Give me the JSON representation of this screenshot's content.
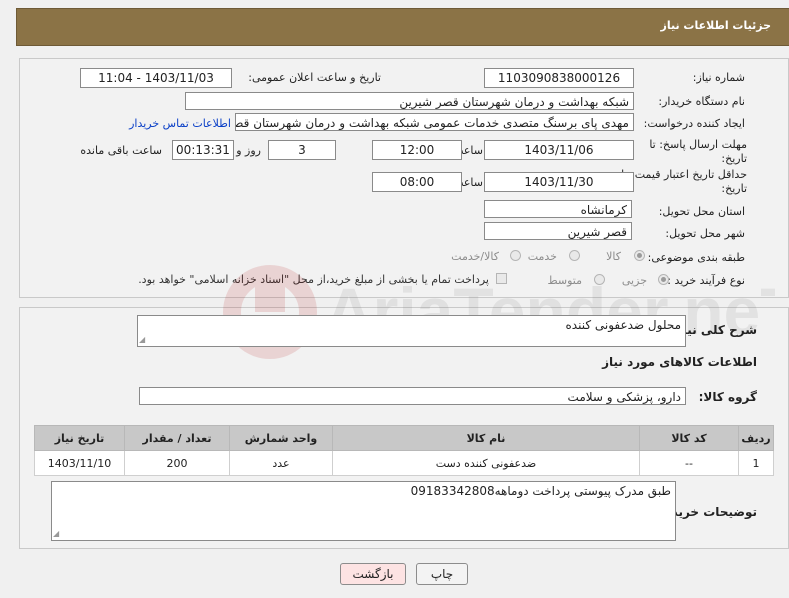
{
  "header": {
    "title": "جزئیات اطلاعات نیاز"
  },
  "form": {
    "need_number_label": "شماره نیاز:",
    "need_number": "1103090838000126",
    "announce_label": "تاریخ و ساعت اعلان عمومی:",
    "announce_value": "1403/11/03 - 11:04",
    "buyer_org_label": "نام دستگاه خریدار:",
    "buyer_org": "شبکه بهداشت و درمان شهرستان قصر شیرین",
    "requester_label": "ایجاد کننده درخواست:",
    "requester": "مهدی پای برسنگ متصدی خدمات عمومی شبکه بهداشت و درمان شهرستان قصر شیرین",
    "contact_link": "اطلاعات تماس خریدار",
    "reply_deadline_label": "مهلت ارسال پاسخ: تا تاریخ:",
    "reply_date": "1403/11/06",
    "time_label": "ساعت",
    "reply_time": "12:00",
    "days_value": "3",
    "days_label": "روز و",
    "remaining_value": "00:13:31",
    "remaining_label": "ساعت باقی مانده",
    "price_deadline_label": "حداقل تاریخ اعتبار قیمت: تا تاریخ:",
    "price_date": "1403/11/30",
    "price_time": "08:00",
    "province_label": "استان محل تحویل:",
    "province": "کرمانشاه",
    "city_label": "شهر محل تحویل:",
    "city": "قصر شیرین",
    "category_label": "طبقه بندی موضوعی:",
    "category_options": [
      "کالا",
      "خدمت",
      "کالا/خدمت"
    ],
    "category_selected": "کالا",
    "process_label": "نوع فرآیند خرید :",
    "process_options": [
      "جزیی",
      "متوسط"
    ],
    "process_selected": "جزیی",
    "payment_note": "پرداخت تمام یا بخشی از مبلغ خرید،از محل \"اسناد خزانه اسلامی\" خواهد بود."
  },
  "description": {
    "label": "شرح کلی نیاز:",
    "value": "محلول ضدعفونی کننده",
    "goods_info_title": "اطلاعات کالاهای مورد نیاز",
    "group_label": "گروه کالا:",
    "group_value": "دارو، پزشکی و سلامت"
  },
  "table": {
    "headers": [
      "ردیف",
      "کد کالا",
      "نام کالا",
      "واحد شمارش",
      "تعداد / مقدار",
      "تاریخ نیاز"
    ],
    "rows": [
      [
        "1",
        "--",
        "ضدعفونی کننده دست",
        "عدد",
        "200",
        "1403/11/10"
      ]
    ]
  },
  "buyer_notes": {
    "label": "توضیحات خریدار:",
    "value": "طبق مدرک پیوستی پرداخت دوماهه09183342808"
  },
  "buttons": {
    "print": "چاپ",
    "back": "بازگشت"
  },
  "watermark": {
    "text": "AriaTender.neT"
  },
  "colors": {
    "header_bg": "#8b7346",
    "link": "#0a3fc7",
    "back_button_bg": "#fde3e3"
  }
}
